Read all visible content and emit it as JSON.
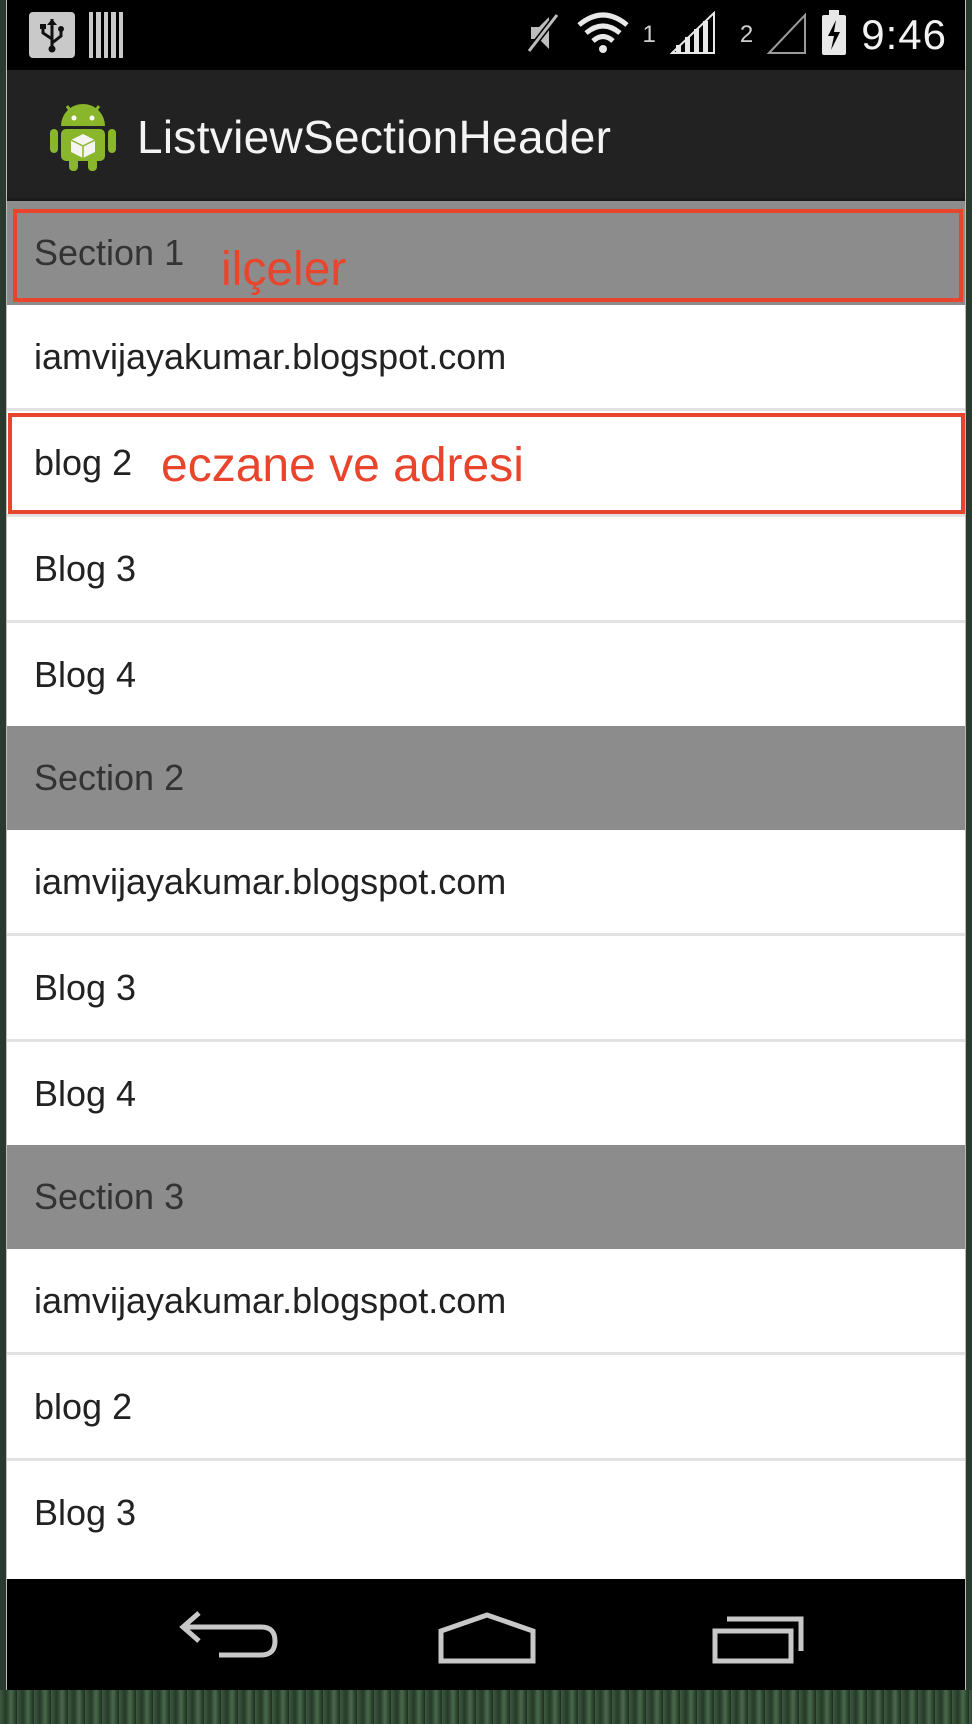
{
  "status_bar": {
    "icons": [
      "usb-icon",
      "storage-icon",
      "mute-icon",
      "wifi-icon",
      "signal-icon",
      "battery-charging-icon"
    ],
    "sim1_label": "1",
    "sim2_label": "2",
    "time": "9:46"
  },
  "action_bar": {
    "app_icon": "android-icon",
    "title": "ListviewSectionHeader"
  },
  "list": {
    "sections": [
      {
        "header": "Section 1",
        "items": [
          "iamvijayakumar.blogspot.com",
          "blog 2",
          "Blog 3",
          "Blog 4"
        ]
      },
      {
        "header": "Section 2",
        "items": [
          "iamvijayakumar.blogspot.com",
          "Blog 3",
          "Blog 4"
        ]
      },
      {
        "header": "Section 3",
        "items": [
          "iamvijayakumar.blogspot.com",
          "blog 2",
          "Blog 3"
        ]
      }
    ]
  },
  "annotations": {
    "section_note": "ilçeler",
    "item_note": "eczane ve adresi",
    "color": "#e8452c"
  },
  "nav_bar": {
    "icons": [
      "back-icon",
      "home-icon",
      "recent-apps-icon"
    ]
  },
  "colors": {
    "status_bar": "#000000",
    "action_bar": "#222222",
    "section_header": "#8c8c8c",
    "row": "#ffffff",
    "divider": "#e2e2e2"
  }
}
